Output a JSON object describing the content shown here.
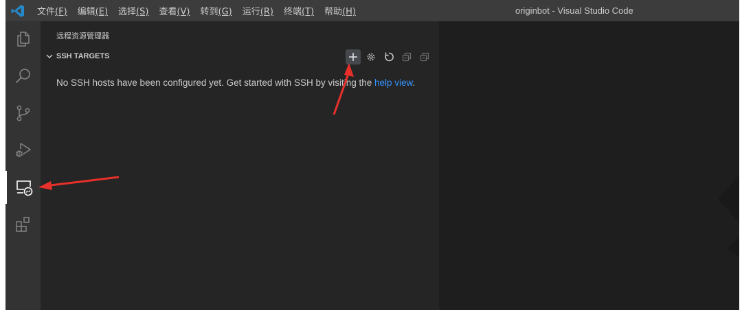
{
  "window": {
    "title": "originbot - Visual Studio Code"
  },
  "menu": [
    {
      "label": "文件",
      "mnemonic": "(F)"
    },
    {
      "label": "编辑",
      "mnemonic": "(E)"
    },
    {
      "label": "选择",
      "mnemonic": "(S)"
    },
    {
      "label": "查看",
      "mnemonic": "(V)"
    },
    {
      "label": "转到",
      "mnemonic": "(G)"
    },
    {
      "label": "运行",
      "mnemonic": "(R)"
    },
    {
      "label": "终端",
      "mnemonic": "(T)"
    },
    {
      "label": "帮助",
      "mnemonic": "(H)"
    }
  ],
  "activity_bar": {
    "items": [
      {
        "name": "explorer",
        "icon": "files-icon",
        "active": false
      },
      {
        "name": "search",
        "icon": "search-icon",
        "active": false
      },
      {
        "name": "source-control",
        "icon": "source-control-icon",
        "active": false
      },
      {
        "name": "run-debug",
        "icon": "run-debug-icon",
        "active": false
      },
      {
        "name": "remote-explorer",
        "icon": "remote-explorer-icon",
        "active": true
      },
      {
        "name": "extensions",
        "icon": "extensions-icon",
        "active": false
      }
    ]
  },
  "sidebar": {
    "title": "远程资源管理器",
    "section": {
      "title": "SSH TARGETS",
      "expanded": true,
      "actions": [
        "add-icon",
        "gear-icon",
        "refresh-icon",
        "collapse-all-icon",
        "collapse-all-icon"
      ]
    },
    "empty_message": {
      "text": "No SSH hosts have been configured yet. Get started with SSH by visiting the ",
      "link": "help view",
      "suffix": "."
    }
  },
  "colors": {
    "titlebar": "#3c3c3c",
    "activity_bar": "#333333",
    "sidebar": "#252526",
    "editor": "#1e1e1e",
    "text": "#cccccc",
    "link": "#3794ff",
    "vscode_blue": "#2489ca",
    "annotation_arrow": "#e8302a"
  }
}
